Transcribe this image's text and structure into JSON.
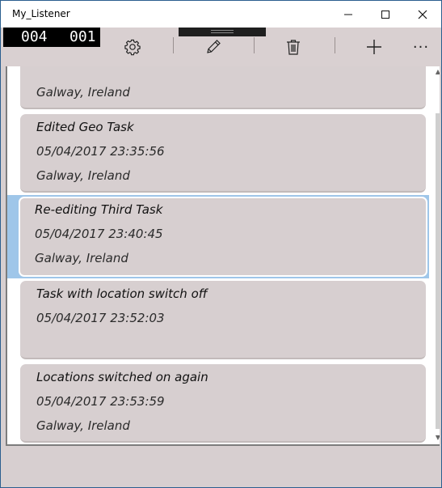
{
  "window": {
    "title": "My_Listener"
  },
  "appbar": {
    "counter_left": "004",
    "counter_right": "001",
    "icons": {
      "settings": "gear-icon",
      "edit": "pencil-icon",
      "delete": "trash-icon",
      "add": "plus-icon",
      "more": "ellipsis-icon"
    },
    "more_label": "···"
  },
  "list": {
    "partial_top": {
      "line1": "",
      "line2": "",
      "line3": "Galway, Ireland"
    },
    "items": [
      {
        "title": "Edited Geo Task",
        "datetime": "05/04/2017 23:35:56",
        "location": "Galway, Ireland",
        "selected": false
      },
      {
        "title": "Re-editing Third Task",
        "datetime": "05/04/2017 23:40:45",
        "location": "Galway, Ireland",
        "selected": true
      },
      {
        "title": "Task with location switch off",
        "datetime": "05/04/2017 23:52:03",
        "location": "",
        "selected": false
      },
      {
        "title": "Locations switched on again",
        "datetime": "05/04/2017 23:53:59",
        "location": "Galway, Ireland",
        "selected": false
      }
    ]
  },
  "colors": {
    "card": "#d7cfd0",
    "selection": "#9fc6e9",
    "counter_bg": "#000000"
  }
}
